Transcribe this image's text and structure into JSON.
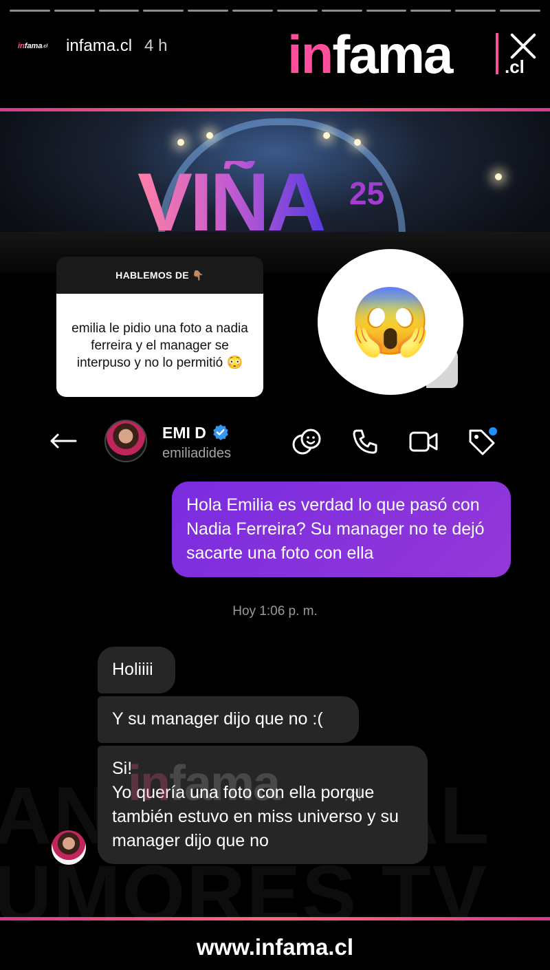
{
  "story": {
    "progress_segments": 12,
    "account_name": "infama.cl",
    "mini_logo": [
      "in",
      "fama",
      ".cl"
    ],
    "time_ago": "4 h",
    "brand_logo": {
      "part1": "in",
      "part2": "fama",
      "suffix": ".cl"
    }
  },
  "hero": {
    "logo_text": "VIÑA",
    "logo_sup": "25"
  },
  "question_card": {
    "header": "HABLEMOS DE 👇🏽",
    "body": "emilia le pidio una foto a nadia ferreira y el manager se interpuso y no lo permitió 😳"
  },
  "reaction_emoji": "😱",
  "chat": {
    "contact_name": "EMI D",
    "contact_handle": "emiliadides",
    "outgoing_message": "Hola Emilia es verdad lo que pasó con Nadia Ferreira? Su  manager no te dejó sacarte una foto con ella",
    "timestamp": "Hoy 1:06 p. m.",
    "incoming": [
      "Holiiii",
      "Y su manager dijo que no :(",
      "Si!\nYo quería una foto con ella porque también estuvo en miss universo y su manager dijo que no"
    ],
    "icons": [
      "back-arrow-icon",
      "avatar",
      "verified-icon",
      "emoji-link-icon",
      "phone-icon",
      "video-icon",
      "tag-icon"
    ]
  },
  "watermark": {
    "text_a": "in",
    "text_b": "fama",
    "suffix": ".cl"
  },
  "footer": {
    "url": "www.infama.cl"
  },
  "colors": {
    "accent_pink": "#ff4f9c",
    "outgoing_bubble": "#8a33dc",
    "incoming_bubble": "#262626",
    "notification_dot": "#1e90ff"
  }
}
